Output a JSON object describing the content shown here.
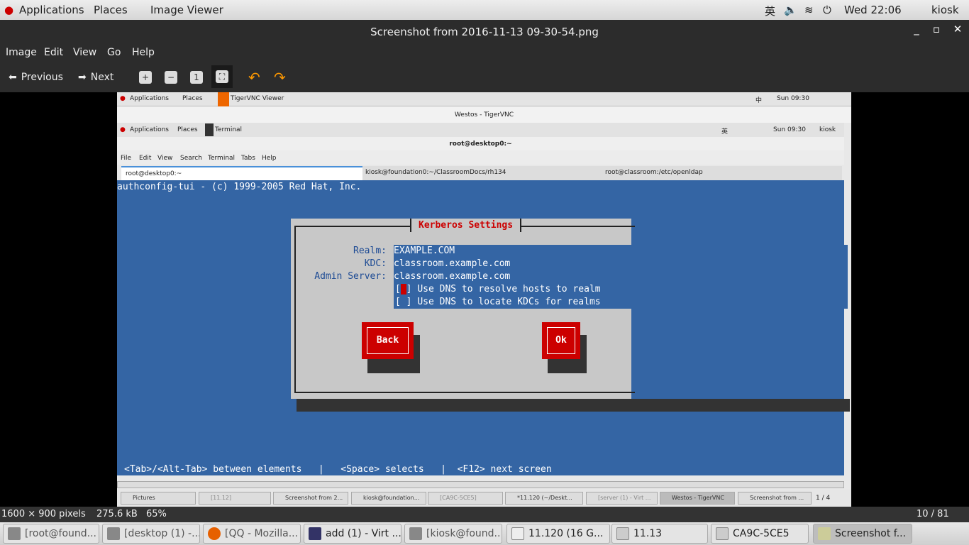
{
  "topbar": {
    "applications": "Applications",
    "places": "Places",
    "app": "Image Viewer",
    "ime": "英",
    "clock": "Wed 22:06",
    "user": "kiosk"
  },
  "window": {
    "title": "Screenshot from 2016-11-13 09-30-54.png"
  },
  "menu": [
    "Image",
    "Edit",
    "View",
    "Go",
    "Help"
  ],
  "toolbar": {
    "previous": "Previous",
    "next": "Next"
  },
  "inner": {
    "topbar": {
      "applications": "Applications",
      "places": "Places",
      "app": "TigerVNC Viewer",
      "ime": "中",
      "clock": "Sun 09:30"
    },
    "vnc_title": "Westos - TigerVNC",
    "gnome": {
      "applications": "Applications",
      "places": "Places",
      "app": "Terminal",
      "ime": "英",
      "clock": "Sun 09:30",
      "user": "kiosk"
    },
    "term_title": "root@desktop0:~",
    "term_menu": [
      "File",
      "Edit",
      "View",
      "Search",
      "Terminal",
      "Tabs",
      "Help"
    ],
    "tabs": [
      "root@desktop0:~",
      "kiosk@foundation0:~/ClassroomDocs/rh134",
      "root@classroom:/etc/openldap"
    ],
    "header": "authconfig-tui - (c) 1999-2005 Red Hat, Inc.",
    "dialog": {
      "title": "Kerberos Settings",
      "realm_label": "Realm:",
      "realm": "EXAMPLE.COM",
      "kdc_label": "KDC:",
      "kdc": "classroom.example.com",
      "admin_label": "Admin Server:",
      "admin": "classroom.example.com",
      "dns_hosts": "Use DNS to resolve hosts to realm",
      "dns_kdcs": "Use DNS to locate KDCs for realms",
      "back": "Back",
      "ok": "Ok"
    },
    "footer": "<Tab>/<Alt-Tab> between elements   |   <Space> selects   |  <F12> next screen",
    "tasks": [
      "Pictures",
      "[11.12]",
      "Screenshot from 2...",
      "kiosk@foundation...",
      "[CA9C-5CE5]",
      "*11.120 (~/Deskt...",
      "[server (1) - Virt ...",
      "Westos - TigerVNC",
      "Screenshot from ..."
    ],
    "workspace": "1 / 4"
  },
  "status": {
    "dimensions": "1600 × 900 pixels",
    "size": "275.6 kB",
    "zoom": "65%",
    "position": "10 / 81"
  },
  "tasks": [
    "[root@found...",
    "[desktop (1) -...",
    "[QQ - Mozilla...",
    "add (1) - Virt ...",
    "[kiosk@found...",
    "11.120 (16 G...",
    "11.13",
    "CA9C-5CE5",
    "Screenshot f..."
  ]
}
